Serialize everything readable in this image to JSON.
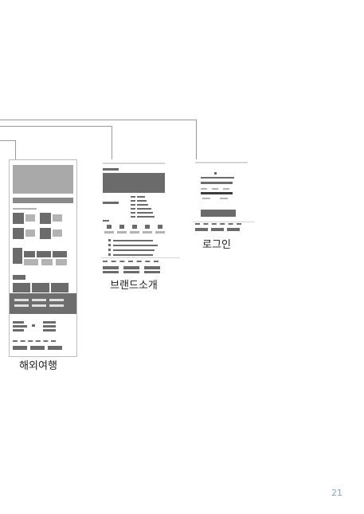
{
  "pages": [
    {
      "caption": "해외여행"
    },
    {
      "caption": "브랜드소개"
    },
    {
      "caption": "로그인"
    }
  ],
  "page_number": "21"
}
